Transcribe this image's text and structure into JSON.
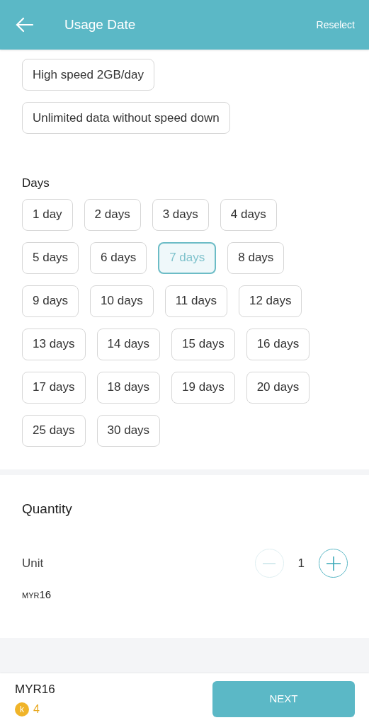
{
  "header": {
    "title": "Usage Date",
    "action": "Reselect"
  },
  "plans": [
    {
      "label": "High speed 2GB/day",
      "selected": false
    },
    {
      "label": "Unlimited data without speed down",
      "selected": false
    }
  ],
  "days": {
    "title": "Days",
    "options": [
      {
        "label": "1 day",
        "selected": false
      },
      {
        "label": "2 days",
        "selected": false
      },
      {
        "label": "3 days",
        "selected": false
      },
      {
        "label": "4 days",
        "selected": false
      },
      {
        "label": "5 days",
        "selected": false
      },
      {
        "label": "6 days",
        "selected": false
      },
      {
        "label": "7 days",
        "selected": true
      },
      {
        "label": "8 days",
        "selected": false
      },
      {
        "label": "9 days",
        "selected": false
      },
      {
        "label": "10 days",
        "selected": false
      },
      {
        "label": "11 days",
        "selected": false
      },
      {
        "label": "12 days",
        "selected": false
      },
      {
        "label": "13 days",
        "selected": false
      },
      {
        "label": "14 days",
        "selected": false
      },
      {
        "label": "15 days",
        "selected": false
      },
      {
        "label": "16 days",
        "selected": false
      },
      {
        "label": "17 days",
        "selected": false
      },
      {
        "label": "18 days",
        "selected": false
      },
      {
        "label": "19 days",
        "selected": false
      },
      {
        "label": "20 days",
        "selected": false
      },
      {
        "label": "25 days",
        "selected": false
      },
      {
        "label": "30 days",
        "selected": false
      }
    ]
  },
  "quantity": {
    "title": "Quantity",
    "unit_label": "Unit",
    "value": "1",
    "decrease_disabled": true,
    "price": {
      "currency": "MYR",
      "amount": "16"
    }
  },
  "footer": {
    "total": "MYR16",
    "coin_label": "k",
    "points": "4",
    "button": "NEXT"
  }
}
